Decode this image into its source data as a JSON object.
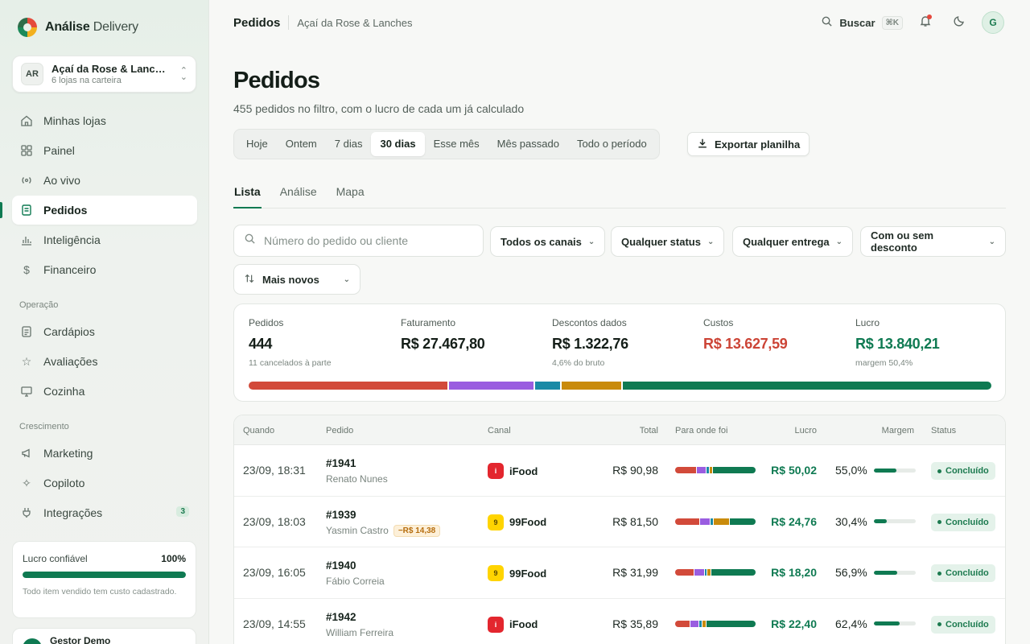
{
  "brand": {
    "name_bold": "Análise",
    "name_light": "Delivery"
  },
  "store": {
    "initials": "AR",
    "name": "Açaí da Rose & Lanches",
    "sub": "6 lojas na carteira"
  },
  "nav": {
    "main": [
      {
        "label": "Minhas lojas",
        "icon": "home-icon"
      },
      {
        "label": "Painel",
        "icon": "grid-icon"
      },
      {
        "label": "Ao vivo",
        "icon": "broadcast-icon"
      },
      {
        "label": "Pedidos",
        "icon": "receipt-icon",
        "active": true
      },
      {
        "label": "Inteligência",
        "icon": "chart-icon"
      },
      {
        "label": "Financeiro",
        "icon": "dollar-icon"
      }
    ],
    "section_ops": "Operação",
    "ops": [
      {
        "label": "Cardápios",
        "icon": "menu-icon"
      },
      {
        "label": "Avaliações",
        "icon": "star-icon"
      },
      {
        "label": "Cozinha",
        "icon": "monitor-icon"
      }
    ],
    "section_growth": "Crescimento",
    "growth": [
      {
        "label": "Marketing",
        "icon": "megaphone-icon"
      },
      {
        "label": "Copiloto",
        "icon": "sparkle-icon"
      },
      {
        "label": "Integrações",
        "icon": "plug-icon",
        "badge": "3"
      }
    ]
  },
  "trust": {
    "label": "Lucro confiável",
    "value": "100%",
    "progress": 1.0,
    "note": "Todo item vendido tem custo cadastrado."
  },
  "user": {
    "initial": "G",
    "name": "Gestor Demo"
  },
  "topbar": {
    "title": "Pedidos",
    "store": "Açaí da Rose & Lanches",
    "search_label": "Buscar",
    "shortcut": "⌘K",
    "avatar": "G"
  },
  "page": {
    "title": "Pedidos",
    "subtitle": "455 pedidos no filtro, com o lucro de cada um já calculado"
  },
  "periods": [
    "Hoje",
    "Ontem",
    "7 dias",
    "30 dias",
    "Esse mês",
    "Mês passado",
    "Todo o período"
  ],
  "active_period": "30 dias",
  "export_label": "Exportar planilha",
  "tabs": [
    "Lista",
    "Análise",
    "Mapa"
  ],
  "filters": {
    "search_placeholder": "Número do pedido ou cliente",
    "channel": "Todos os canais",
    "status": "Qualquer status",
    "delivery": "Qualquer entrega",
    "discount": "Com ou sem desconto",
    "sort": "Mais novos"
  },
  "summary": {
    "orders_label": "Pedidos",
    "orders_value": "444",
    "orders_note": "11 cancelados à parte",
    "revenue_label": "Faturamento",
    "revenue_value": "R$ 27.467,80",
    "discounts_label": "Descontos dados",
    "discounts_value": "R$ 1.322,76",
    "discounts_note": "4,6% do bruto",
    "costs_label": "Custos",
    "costs_value": "R$ 13.627,59",
    "profit_label": "Lucro",
    "profit_value": "R$ 13.840,21",
    "profit_note": "margem 50,4%",
    "breakdown": [
      {
        "fraction": 0.27,
        "color": "#d24a3a"
      },
      {
        "fraction": 0.115,
        "color": "#9a5de0"
      },
      {
        "fraction": 0.034,
        "color": "#1a8aa6"
      },
      {
        "fraction": 0.08,
        "color": "#c98b0c"
      },
      {
        "fraction": 0.501,
        "color": "#0f7a52"
      }
    ]
  },
  "table": {
    "headers": {
      "when": "Quando",
      "order": "Pedido",
      "channel": "Canal",
      "total": "Total",
      "where": "Para onde foi",
      "profit": "Lucro",
      "margin": "Margem",
      "status": "Status"
    },
    "rows": [
      {
        "when": "23/09, 18:31",
        "id": "#1941",
        "customer": "Renato Nunes",
        "discount": "",
        "channel": "iFood",
        "channel_glyph": "i",
        "channel_bg": "#e3262e",
        "channel_fg": "#ffffff",
        "total": "R$ 90,98",
        "profit": "R$ 50,02",
        "margin": "55,0%",
        "margin_value": 0.55,
        "status": "Concluído",
        "split": [
          0.27,
          0.12,
          0.03,
          0.03,
          0.55
        ]
      },
      {
        "when": "23/09, 18:03",
        "id": "#1939",
        "customer": "Yasmin Castro",
        "discount": "−R$ 14,38",
        "channel": "99Food",
        "channel_glyph": "9",
        "channel_bg": "#ffd400",
        "channel_fg": "#5a4a00",
        "total": "R$ 81,50",
        "profit": "R$ 24,76",
        "margin": "30,4%",
        "margin_value": 0.304,
        "status": "Concluído",
        "split": [
          0.31,
          0.13,
          0.03,
          0.2,
          0.33
        ]
      },
      {
        "when": "23/09, 16:05",
        "id": "#1940",
        "customer": "Fábio Correia",
        "discount": "",
        "channel": "99Food",
        "channel_glyph": "9",
        "channel_bg": "#ffd400",
        "channel_fg": "#5a4a00",
        "total": "R$ 31,99",
        "profit": "R$ 18,20",
        "margin": "56,9%",
        "margin_value": 0.569,
        "status": "Concluído",
        "split": [
          0.24,
          0.12,
          0.03,
          0.04,
          0.57
        ]
      },
      {
        "when": "23/09, 14:55",
        "id": "#1942",
        "customer": "William Ferreira",
        "discount": "",
        "channel": "iFood",
        "channel_glyph": "i",
        "channel_bg": "#e3262e",
        "channel_fg": "#ffffff",
        "total": "R$ 35,89",
        "profit": "R$ 22,40",
        "margin": "62,4%",
        "margin_value": 0.624,
        "status": "Concluído",
        "split": [
          0.19,
          0.1,
          0.03,
          0.04,
          0.64
        ]
      }
    ]
  },
  "colors": {
    "accent": "#0f7a52",
    "cost": "#d24a3a",
    "platform": "#9a5de0",
    "delivery": "#1a8aa6",
    "discount": "#c98b0c",
    "profit": "#0f7a52"
  }
}
